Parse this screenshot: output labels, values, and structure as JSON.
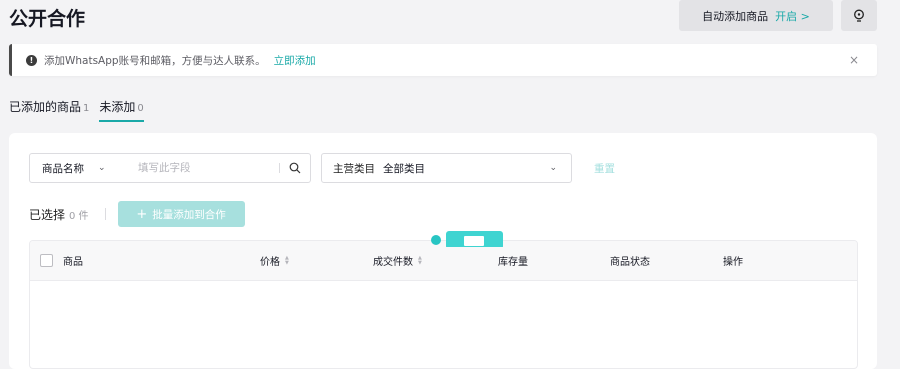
{
  "header": {
    "title": "公开合作",
    "auto_add_label": "自动添加商品",
    "auto_add_action": "开启 >"
  },
  "notice": {
    "text": "添加WhatsApp账号和邮箱，方便与达人联系。",
    "link": "立即添加",
    "close": "×"
  },
  "tabs": [
    {
      "label": "已添加的商品",
      "count": "1"
    },
    {
      "label": "未添加",
      "count": "0"
    }
  ],
  "filters": {
    "field_select": "商品名称",
    "input_placeholder": "填写此字段",
    "category_label": "主营类目",
    "category_value": "全部类目",
    "reset": "重置"
  },
  "selection": {
    "label": "已选择",
    "count": "0 件",
    "batch_button": "批量添加到合作"
  },
  "table": {
    "columns": [
      "商品",
      "价格",
      "成交件数",
      "库存量",
      "商品状态",
      "操作"
    ]
  },
  "colors": {
    "accent": "#1aa9a8",
    "accent_disabled": "#a7e0de"
  }
}
